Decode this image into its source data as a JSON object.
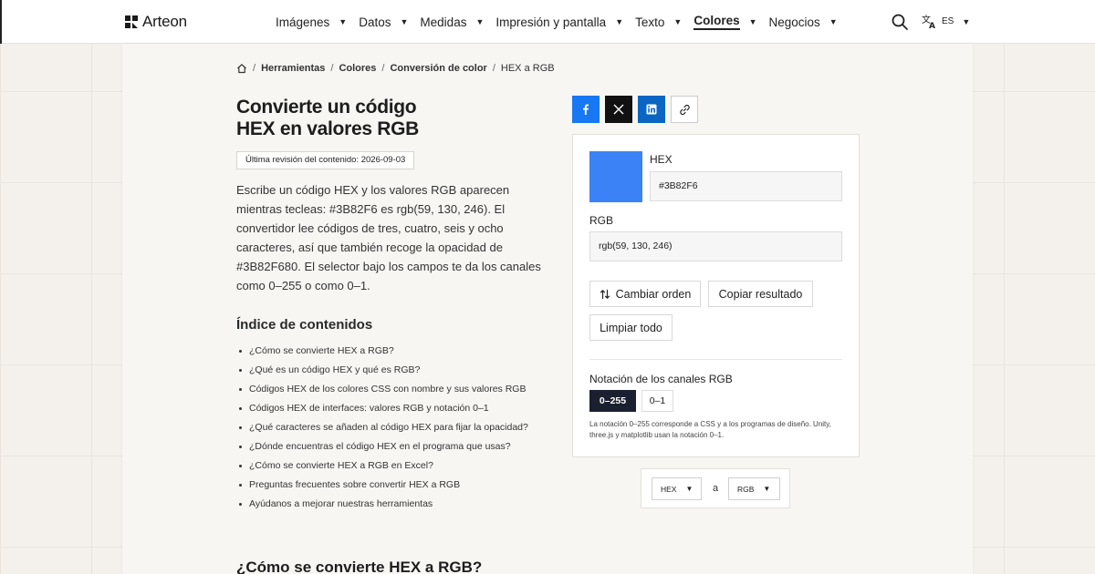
{
  "header": {
    "logo_text": "Arteon",
    "nav": [
      {
        "label": "Imágenes",
        "active": false
      },
      {
        "label": "Datos",
        "active": false
      },
      {
        "label": "Medidas",
        "active": false
      },
      {
        "label": "Impresión y pantalla",
        "active": false
      },
      {
        "label": "Texto",
        "active": false
      },
      {
        "label": "Colores",
        "active": true
      },
      {
        "label": "Negocios",
        "active": false
      }
    ],
    "language": "ES"
  },
  "breadcrumb": {
    "items": [
      "Herramientas",
      "Colores",
      "Conversión de color"
    ],
    "current": "HEX a RGB"
  },
  "page": {
    "title_line1": "Convierte un código",
    "title_line2": "HEX en valores RGB",
    "revision": "Última revisión del contenido: 2026-09-03",
    "intro": "Escribe un código HEX y los valores RGB aparecen mientras tecleas: #3B82F6 es rgb(59, 130, 246). El convertidor lee códigos de tres, cuatro, seis y ocho caracteres, así que también recoge la opacidad de #3B82F680. El selector bajo los campos te da los canales como 0–255 o como 0–1.",
    "toc_title": "Índice de contenidos",
    "toc": [
      "¿Cómo se convierte HEX a RGB?",
      "¿Qué es un código HEX y qué es RGB?",
      "Códigos HEX de los colores CSS con nombre y sus valores RGB",
      "Códigos HEX de interfaces: valores RGB y notación 0–1",
      "¿Qué caracteres se añaden al código HEX para fijar la opacidad?",
      "¿Dónde encuentras el código HEX en el programa que usas?",
      "¿Cómo se convierte HEX a RGB en Excel?",
      "Preguntas frecuentes sobre convertir HEX a RGB",
      "Ayúdanos a mejorar nuestras herramientas"
    ],
    "section_title": "¿Cómo se convierte HEX a RGB?"
  },
  "converter": {
    "swatch_color": "#3b82f6",
    "hex_label": "HEX",
    "hex_value": "#3B82F6",
    "rgb_label": "RGB",
    "rgb_value": "rgb(59, 130, 246)",
    "swap_label": "Cambiar orden",
    "copy_label": "Copiar resultado",
    "clear_label": "Limpiar todo",
    "notation_label": "Notación de los canales RGB",
    "notation_options": [
      "0–255",
      "0–1"
    ],
    "note": "La notación 0–255 corresponde a CSS y a los programas de diseño. Unity, three.js y matplotlib usan la notación 0–1."
  },
  "switcher": {
    "from": "HEX",
    "connector": "a",
    "to": "RGB"
  },
  "colors": {
    "facebook": "#1877f2",
    "x": "#111111",
    "linkedin": "#0a66c2",
    "notation_active": "#1b2030"
  }
}
